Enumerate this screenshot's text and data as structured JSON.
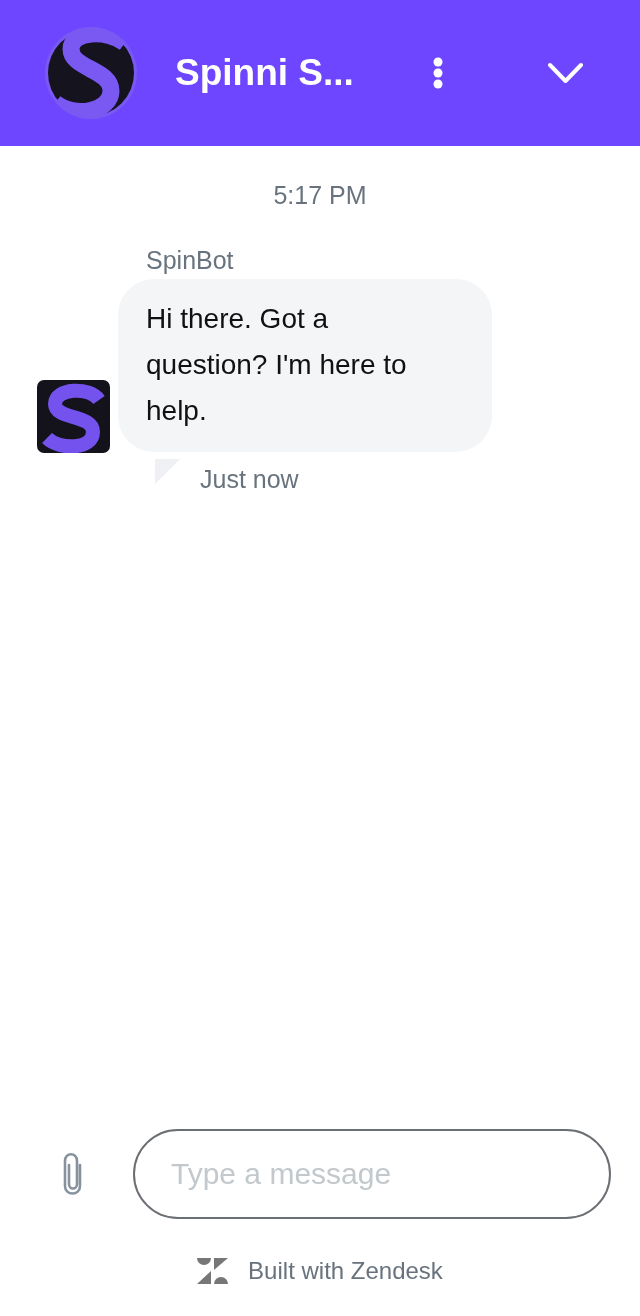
{
  "header": {
    "title": "Spinni S..."
  },
  "chat": {
    "timestamp": "5:17 PM",
    "messages": [
      {
        "sender": "SpinBot",
        "text": "Hi there. Got a question? I'm here to help.",
        "status": "Just now"
      }
    ]
  },
  "composer": {
    "placeholder": "Type a message"
  },
  "footer": {
    "branding": "Built with Zendesk"
  }
}
